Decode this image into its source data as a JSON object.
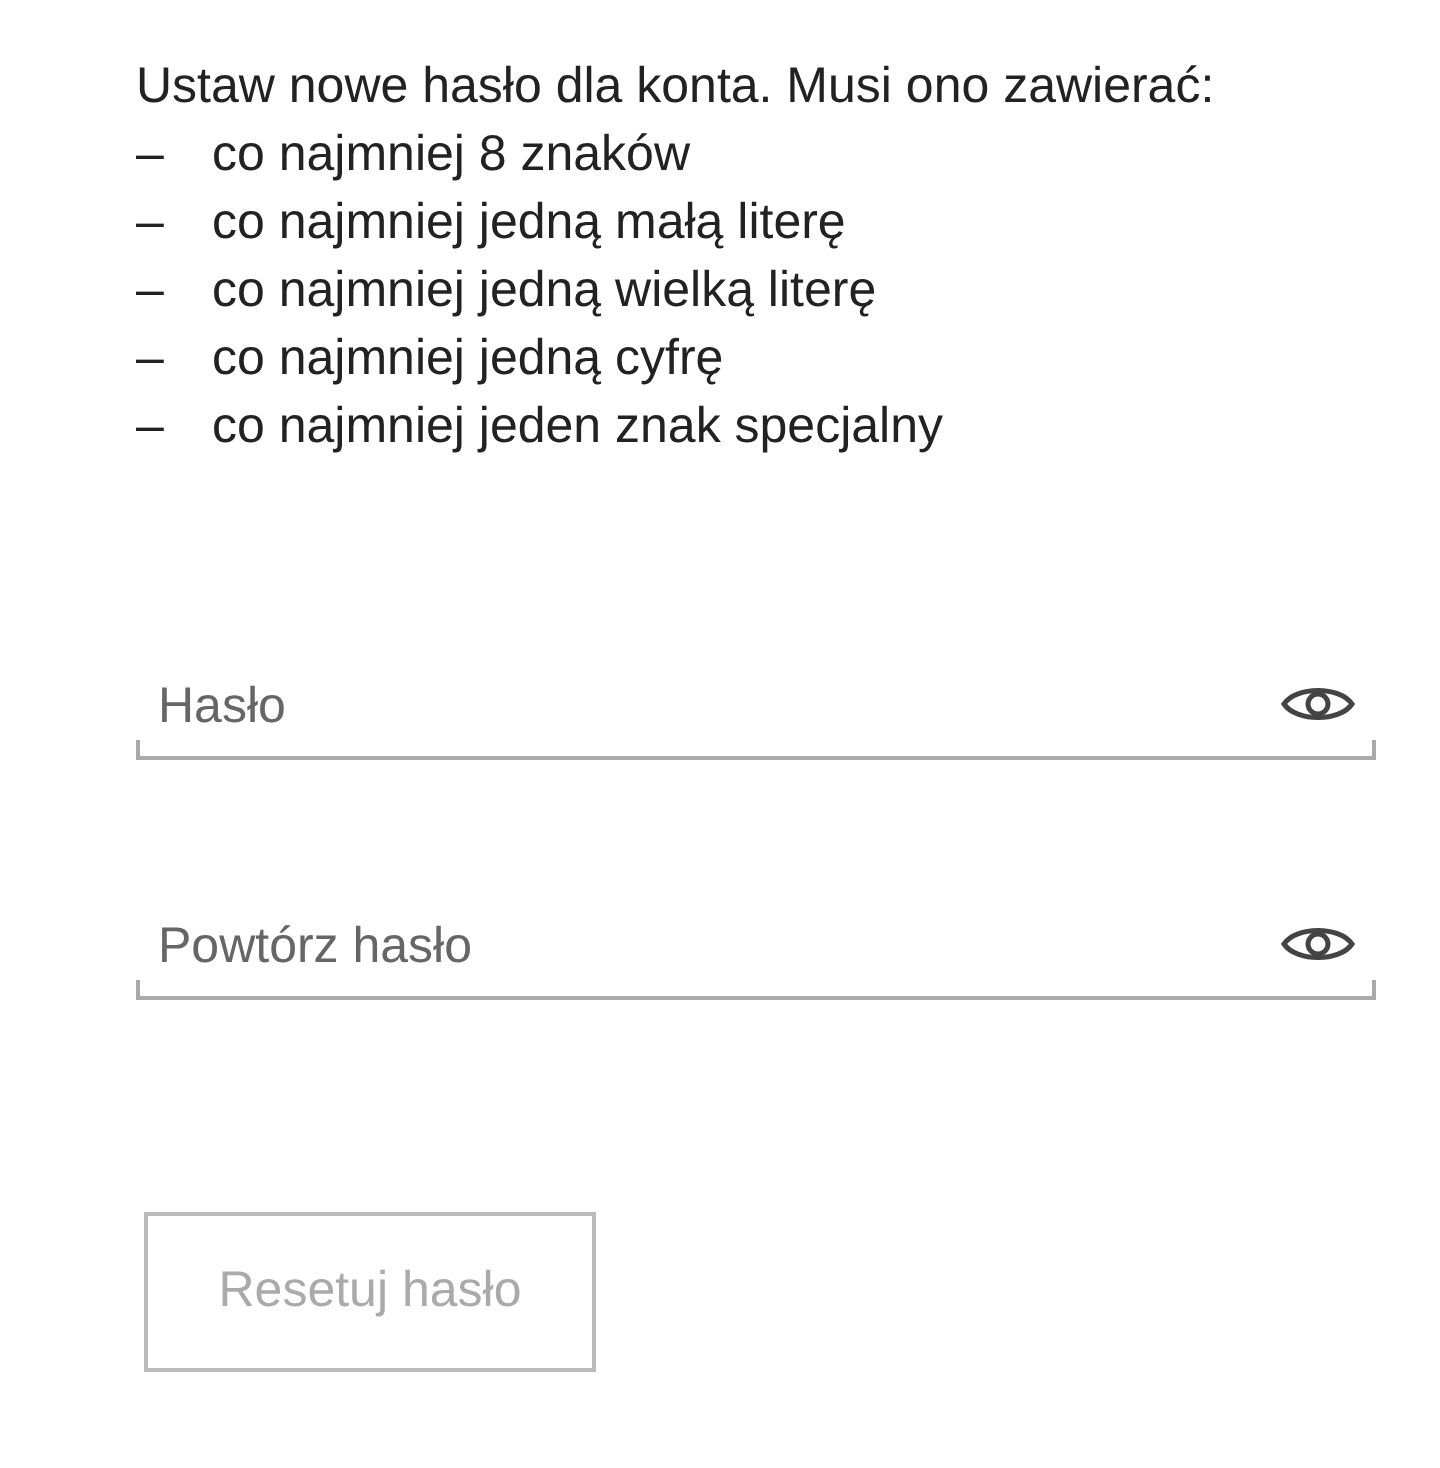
{
  "instructions": {
    "intro": "Ustaw nowe hasło dla konta. Musi ono zawierać:",
    "requirements": [
      {
        "bullet": "–",
        "text": "co najmniej 8 znaków"
      },
      {
        "bullet": "–",
        "text": "co najmniej jedną małą literę"
      },
      {
        "bullet": "–",
        "text": "co najmniej jedną wielką literę"
      },
      {
        "bullet": "–",
        "text": "co najmniej jedną cyfrę"
      },
      {
        "bullet": "–",
        "text": "co najmniej jeden znak specjalny"
      }
    ]
  },
  "fields": [
    {
      "placeholder": "Hasło"
    },
    {
      "placeholder": "Powtórz hasło"
    }
  ],
  "submit_button": {
    "label": "Resetuj hasło",
    "disabled": true
  }
}
